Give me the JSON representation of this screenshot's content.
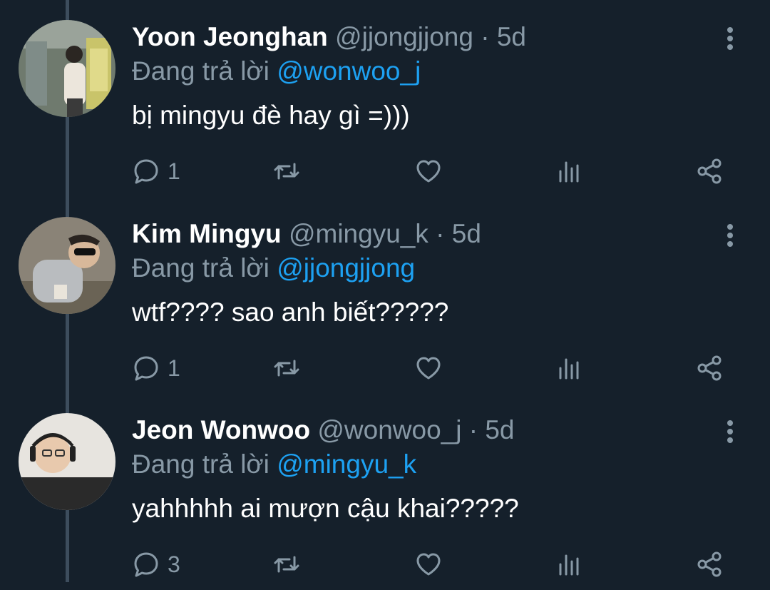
{
  "tweets": [
    {
      "name": "Yoon Jeonghan",
      "handle": "@jjongjjong",
      "separator": "·",
      "time": "5d",
      "reply_prefix": "Đang trả lời",
      "reply_to": "@wonwoo_j",
      "text": "bị mingyu đè hay gì =)))",
      "reply_count": "1",
      "avatar_icon": "avatar-photo"
    },
    {
      "name": "Kim Mingyu",
      "handle": "@mingyu_k",
      "separator": "·",
      "time": "5d",
      "reply_prefix": "Đang trả lời",
      "reply_to": "@jjongjjong",
      "text": "wtf???? sao anh biết?????",
      "reply_count": "1",
      "avatar_icon": "avatar-photo"
    },
    {
      "name": "Jeon Wonwoo",
      "handle": "@wonwoo_j",
      "separator": "·",
      "time": "5d",
      "reply_prefix": "Đang trả lời",
      "reply_to": "@mingyu_k",
      "text": "yahhhhh ai mượn cậu khai?????",
      "reply_count": "3",
      "avatar_icon": "avatar-photo"
    }
  ],
  "colors": {
    "background": "#15202b",
    "primary_text": "#ffffff",
    "secondary_text": "#8899a6",
    "link": "#1da1f2",
    "thread_line": "#3d4d5d"
  }
}
